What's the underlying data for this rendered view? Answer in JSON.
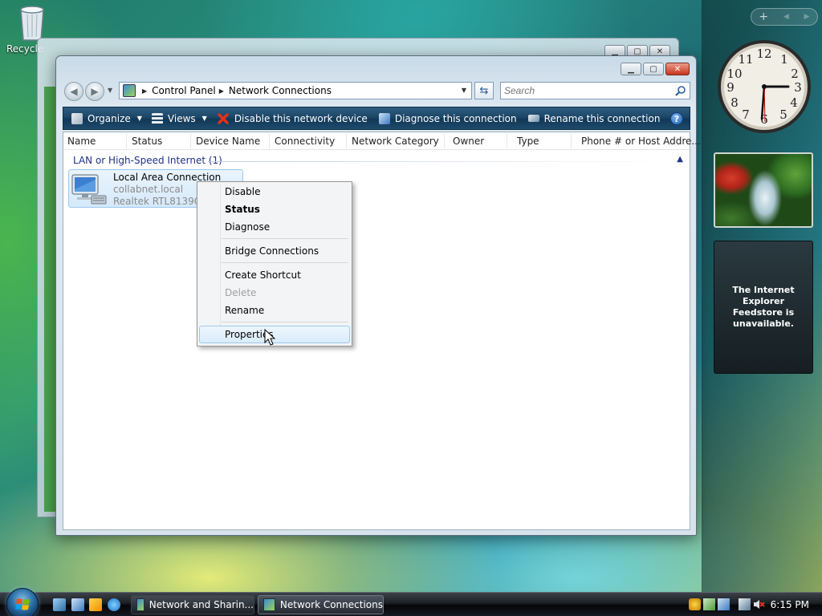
{
  "desktop": {
    "recycle_bin_label": "Recycle"
  },
  "background_window": {
    "buttons": [
      "minimize",
      "maximize",
      "close"
    ]
  },
  "window": {
    "title": "Network Connections",
    "address": {
      "crumbs": [
        "Control Panel",
        "Network Connections"
      ]
    },
    "search": {
      "placeholder": "Search"
    },
    "toolbar": {
      "organize": "Organize",
      "views": "Views",
      "disable": "Disable this network device",
      "diagnose": "Diagnose this connection",
      "rename": "Rename this connection",
      "more": "»"
    },
    "columns": [
      "Name",
      "Status",
      "Device Name",
      "Connectivity",
      "Network Category",
      "Owner",
      "Type",
      "Phone # or Host Addre..."
    ],
    "group": {
      "label": "LAN or High-Speed Internet (1)"
    },
    "item": {
      "name": "Local Area Connection",
      "network": "collabnet.local",
      "device": "Realtek RTL8139C+ F"
    }
  },
  "context_menu": {
    "items": {
      "disable": "Disable",
      "status": "Status",
      "diagnose": "Diagnose",
      "bridge": "Bridge Connections",
      "shortcut": "Create Shortcut",
      "delete": "Delete",
      "rename": "Rename",
      "properties": "Properties"
    }
  },
  "sidebar": {
    "controls": {
      "add": "+",
      "prev": "◀",
      "next": "▶"
    },
    "feed_message": "The Internet Explorer\nFeedstore is\nunavailable."
  },
  "taskbar": {
    "tasks": [
      "Network and Sharin...",
      "Network Connections"
    ],
    "clock": "6:15 PM"
  },
  "colors": {
    "toolbar": "#1c4668",
    "group_text": "#1e3287",
    "selection_border": "#99c9ef"
  }
}
